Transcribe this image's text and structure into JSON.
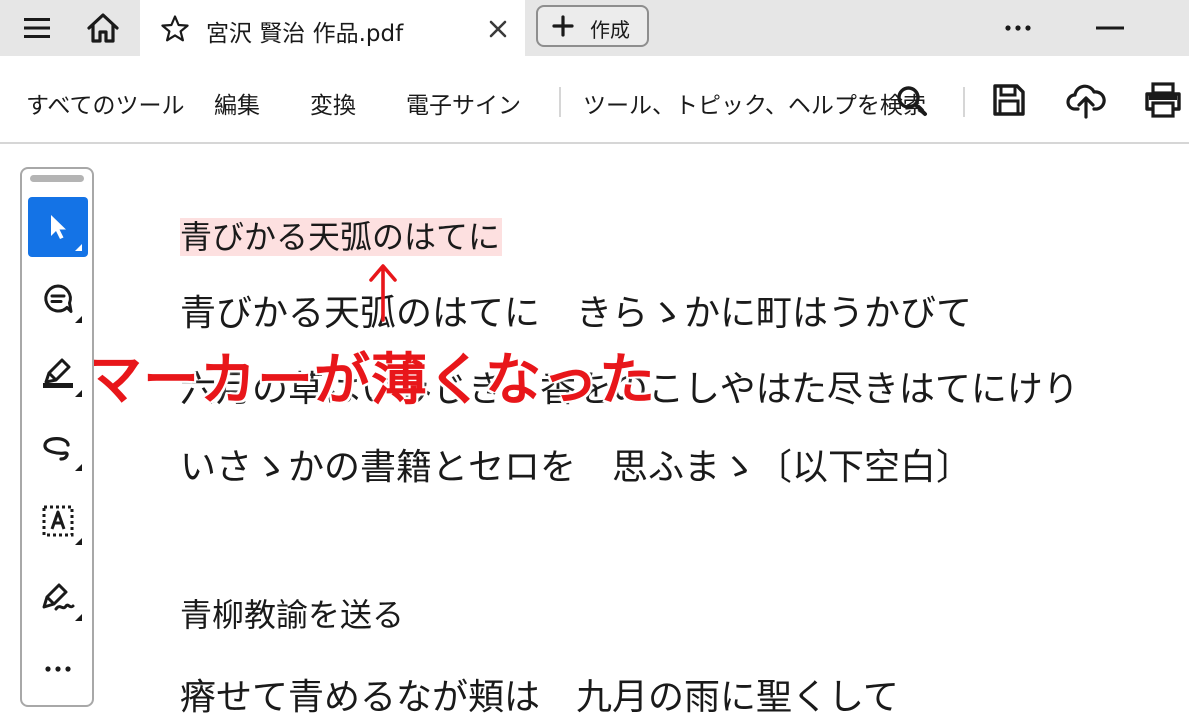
{
  "tabbar": {
    "tab_title": "宮沢 賢治 作品.pdf",
    "create_label": "作成"
  },
  "toolbar": {
    "all_tools": "すべてのツール",
    "edit": "編集",
    "convert": "変換",
    "esign": "電子サイン",
    "search_placeholder": "ツール、トピック、ヘルプを検索"
  },
  "document": {
    "lines": [
      "青びかる天弧のはてに",
      "青びかる天弧のはてに　きらゝかに町はうかびて",
      "六月の草はいみじき　香をのこしやはた尽きはてにけり",
      "いさゝかの書籍とセロを　思ふまゝ〔以下空白〕",
      "青柳教諭を送る",
      "瘠せて青めるなが頬は　九月の雨に聖くして"
    ]
  },
  "annotation": {
    "callout": "マーカーが薄くなった"
  },
  "colors": {
    "accent": "#1473e6",
    "highlight": "#fde0e0",
    "callout": "#e8161a"
  },
  "icons": [
    "menu-icon",
    "home-icon",
    "star-icon",
    "close-icon",
    "plus-icon",
    "more-icon",
    "minimize-icon",
    "search-icon",
    "save-icon",
    "upload-icon",
    "print-icon",
    "select-icon",
    "comment-icon",
    "highlight-icon",
    "draw-icon",
    "text-box-icon",
    "sign-icon",
    "more-tools-icon"
  ]
}
